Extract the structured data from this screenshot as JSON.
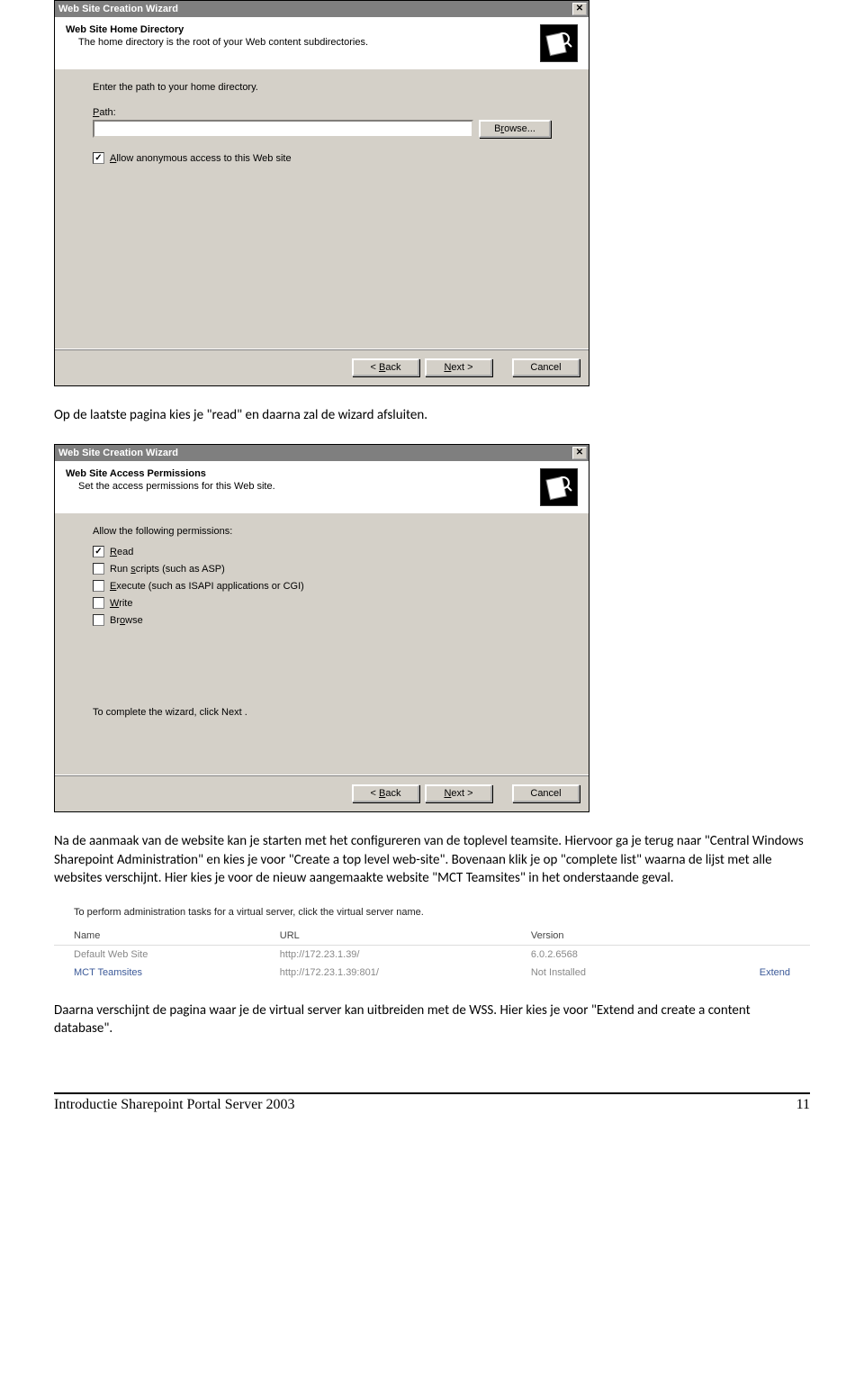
{
  "dialog1": {
    "title": "Web Site Creation Wizard",
    "heading": "Web Site Home Directory",
    "subheading": "The home directory is the root of your Web content subdirectories.",
    "prompt": "Enter the path to your home directory.",
    "path_label": "Path:",
    "path_value": "",
    "browse_label": "Browse...",
    "allow_anon_label": "Allow anonymous access to this Web site",
    "allow_anon_checked": true,
    "back_label": "< Back",
    "next_label": "Next >",
    "cancel_label": "Cancel"
  },
  "paragraph1": "Op de laatste pagina kies je \"read\" en daarna zal de wizard afsluiten.",
  "dialog2": {
    "title": "Web Site Creation Wizard",
    "heading": "Web Site Access Permissions",
    "subheading": "Set the access permissions for this Web site.",
    "intro": "Allow the following permissions:",
    "perms": [
      {
        "label": "Read",
        "checked": true
      },
      {
        "label": "Run scripts (such as ASP)",
        "checked": false
      },
      {
        "label": "Execute (such as ISAPI applications or CGI)",
        "checked": false
      },
      {
        "label": "Write",
        "checked": false
      },
      {
        "label": "Browse",
        "checked": false
      }
    ],
    "complete": "To complete the wizard, click Next .",
    "back_label": "< Back",
    "next_label": "Next >",
    "cancel_label": "Cancel"
  },
  "paragraph2": "Na de aanmaak van de website kan je starten met het configureren van de toplevel teamsite. Hiervoor ga je terug naar \"Central Windows Sharepoint Administration\" en kies je voor \"Create a top level web-site\". Bovenaan klik je op \"complete list\" waarna de lijst met alle websites verschijnt. Hier kies je voor de nieuw aangemaakte website \"MCT Teamsites\" in het onderstaande geval.",
  "vsl": {
    "intro": "To perform administration tasks for a virtual server, click the virtual server name.",
    "cols": {
      "name": "Name",
      "url": "URL",
      "version": "Version",
      "blank": ""
    },
    "rows": [
      {
        "name": "Default Web Site",
        "url": "http://172.23.1.39/",
        "version": "6.0.2.6568",
        "extend": ""
      },
      {
        "name": "MCT Teamsites",
        "url": "http://172.23.1.39:801/",
        "version": "Not Installed",
        "extend": "Extend"
      }
    ]
  },
  "paragraph3": "Daarna verschijnt de pagina waar je de virtual server kan uitbreiden met de WSS. Hier kies je voor \"Extend and create a content database\".",
  "footer": {
    "title": "Introductie Sharepoint Portal Server 2003",
    "page": "11"
  }
}
